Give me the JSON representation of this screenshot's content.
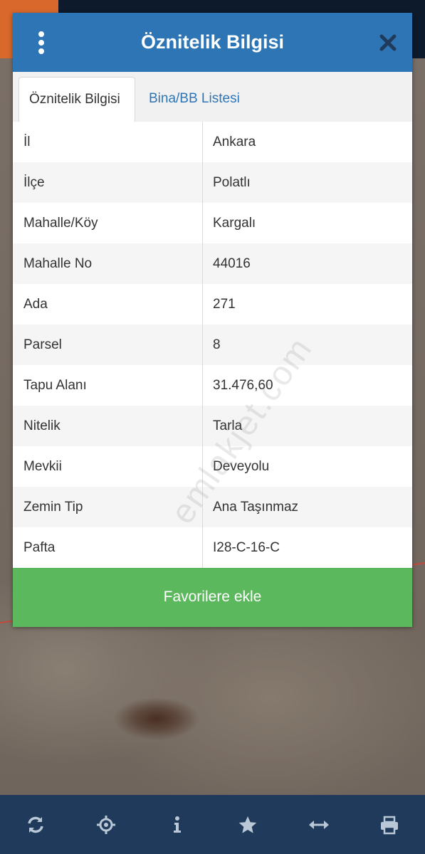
{
  "dialog": {
    "title": "Öznitelik Bilgisi",
    "tabs": [
      {
        "label": "Öznitelik Bilgisi",
        "active": true
      },
      {
        "label": "Bina/BB Listesi",
        "active": false
      }
    ],
    "rows": [
      {
        "key": "İl",
        "value": "Ankara"
      },
      {
        "key": "İlçe",
        "value": "Polatlı"
      },
      {
        "key": "Mahalle/Köy",
        "value": "Kargalı"
      },
      {
        "key": "Mahalle No",
        "value": "44016"
      },
      {
        "key": "Ada",
        "value": "271"
      },
      {
        "key": "Parsel",
        "value": "8"
      },
      {
        "key": "Tapu Alanı",
        "value": "31.476,60"
      },
      {
        "key": "Nitelik",
        "value": "Tarla"
      },
      {
        "key": "Mevkii",
        "value": "Deveyolu"
      },
      {
        "key": "Zemin Tip",
        "value": "Ana Taşınmaz"
      },
      {
        "key": "Pafta",
        "value": "I28-C-16-C"
      }
    ],
    "favorite_button": "Favorilere ekle",
    "watermark": "emlakjet.com",
    "icons": {
      "menu": "menu-icon",
      "close": "close-icon"
    }
  },
  "toolbar": {
    "items": [
      {
        "icon": "refresh-icon"
      },
      {
        "icon": "locate-icon"
      },
      {
        "icon": "info-icon"
      },
      {
        "icon": "star-icon"
      },
      {
        "icon": "measure-icon"
      },
      {
        "icon": "print-icon"
      }
    ]
  },
  "colors": {
    "header": "#2e75b6",
    "accent_link": "#2e75b6",
    "favorite_button": "#5cb85c",
    "toolbar": "#1f3a5a",
    "map_topbar": "#0d1a2c",
    "map_orange": "#d8682c"
  }
}
